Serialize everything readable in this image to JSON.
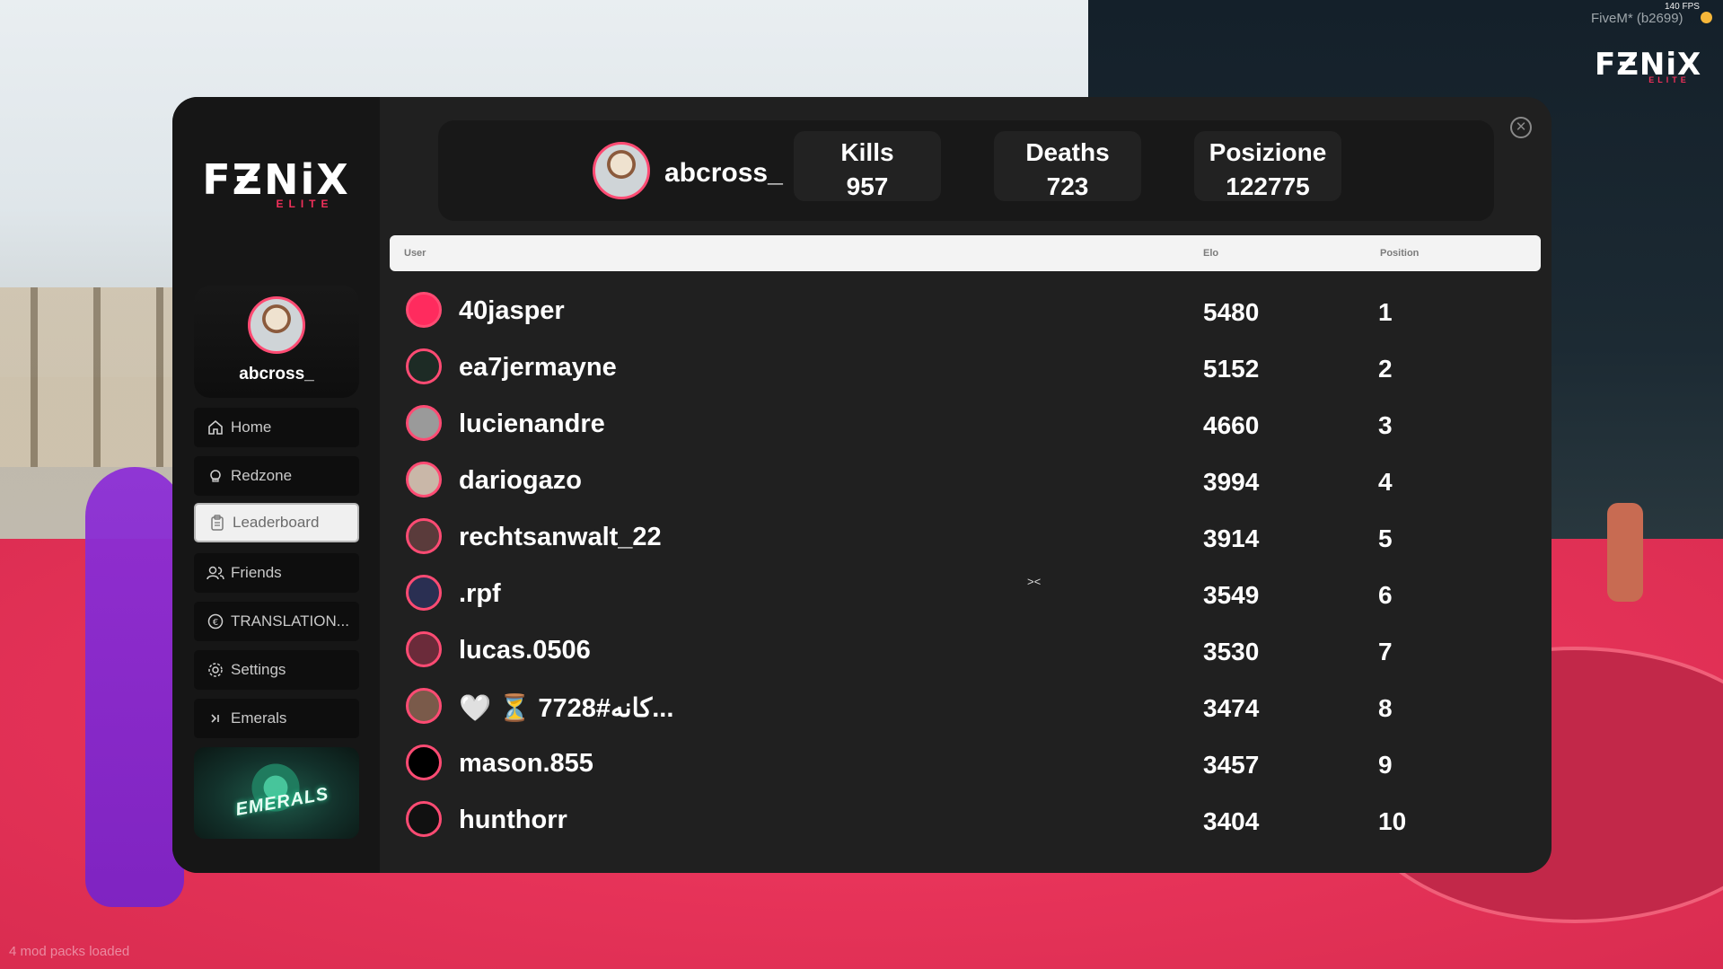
{
  "overlay": {
    "fps": "140 FPS",
    "client_label": "FiveM* (b2699)",
    "mods_loaded": "4 mod packs loaded",
    "corner_brand": "FƵNiX",
    "corner_sub": "ELITE"
  },
  "sidebar": {
    "brand": "FƵNiX",
    "brand_sub": "ELITE",
    "profile": {
      "username": "abcross_"
    },
    "nav": [
      {
        "label": "Home",
        "icon": "home-icon",
        "active": false
      },
      {
        "label": "Redzone",
        "icon": "skull-icon",
        "active": false
      },
      {
        "label": "Leaderboard",
        "icon": "clipboard-icon",
        "active": true
      },
      {
        "label": "Friends",
        "icon": "users-icon",
        "active": false
      },
      {
        "label": "TRANSLATION...",
        "icon": "euro-icon",
        "active": false
      },
      {
        "label": "Settings",
        "icon": "gear-icon",
        "active": false
      },
      {
        "label": "Emerals",
        "icon": "chevron-right-icon",
        "active": false
      }
    ],
    "promo_text": "EMERALS"
  },
  "header": {
    "username": "abcross_",
    "stats": [
      {
        "label": "Kills",
        "value": "957"
      },
      {
        "label": "Deaths",
        "value": "723"
      },
      {
        "label": "Posizione",
        "value": "122775"
      }
    ]
  },
  "table": {
    "columns": {
      "user": "User",
      "elo": "Elo",
      "position": "Position"
    },
    "rows": [
      {
        "user": "40jasper",
        "elo": "5480",
        "position": "1",
        "avatar_color": "#ff2b5e"
      },
      {
        "user": "ea7jermayne",
        "elo": "5152",
        "position": "2",
        "avatar_color": "#1d2b25"
      },
      {
        "user": "lucienandre",
        "elo": "4660",
        "position": "3",
        "avatar_color": "#9a9a9a"
      },
      {
        "user": "dariogazo",
        "elo": "3994",
        "position": "4",
        "avatar_color": "#c9b7a8"
      },
      {
        "user": "rechtsanwalt_22",
        "elo": "3914",
        "position": "5",
        "avatar_color": "#5a3b3b"
      },
      {
        "user": ".rpf",
        "elo": "3549",
        "position": "6",
        "avatar_color": "#2a2f52"
      },
      {
        "user": "lucas.0506",
        "elo": "3530",
        "position": "7",
        "avatar_color": "#6b2b3a"
      },
      {
        "user": "🤍 ⏳ 7728#کانه...",
        "elo": "3474",
        "position": "8",
        "avatar_color": "#7a5a4a"
      },
      {
        "user": "mason.855",
        "elo": "3457",
        "position": "9",
        "avatar_color": "#000000"
      },
      {
        "user": "hunthorr",
        "elo": "3404",
        "position": "10",
        "avatar_color": "#111111"
      }
    ]
  },
  "colors": {
    "accent": "#ff2b5e",
    "panel": "#202020",
    "sidebar": "#161616"
  }
}
